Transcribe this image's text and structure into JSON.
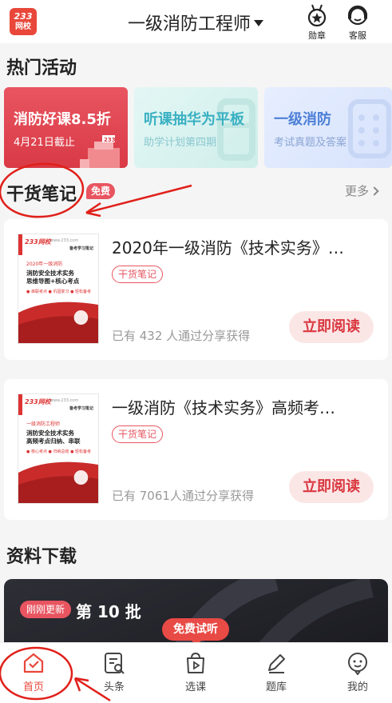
{
  "header": {
    "logo_line1": "233",
    "logo_line2": "网校",
    "title": "一级消防工程师",
    "badge_label": "勋章",
    "service_label": "客服"
  },
  "hot_activities": {
    "title": "热门活动",
    "cards": [
      {
        "title": "消防好课8.5折",
        "subtitle": "4月21日截止",
        "deco": "233"
      },
      {
        "title": "听课抽华为平板",
        "subtitle": "助学计划第四期"
      },
      {
        "title": "一级消防",
        "subtitle": "考试真题及答案"
      }
    ]
  },
  "notes": {
    "title": "干货笔记",
    "badge": "免费",
    "more_label": "更多",
    "items": [
      {
        "title": "2020年一级消防《技术实务》…",
        "tag": "干货笔记",
        "count_text": "已有 432 人通过分享获得",
        "button": "立即阅读",
        "cover": {
          "logo": "233网校",
          "url": "www.233.com",
          "tag": "备考学习笔记",
          "year": "2020年一级消防",
          "line1": "消防安全技术实务",
          "line2": "思维导图+核心考点",
          "dots": "● 串联考点  ● 巩固复习  ● 轻松备考"
        }
      },
      {
        "title": "一级消防《技术实务》高频考…",
        "tag": "干货笔记",
        "count_text": "已有 7061人通过分享获得",
        "button": "立即阅读",
        "cover": {
          "logo": "233网校",
          "url": "www.233.com",
          "tag": "备考学习笔记",
          "year": "一级消防工程师",
          "line1": "消防安全技术实务",
          "line2": "高频考点归纳、串联",
          "dots": "● 核心考点  ● 归纳总结  ● 轻松备考"
        }
      }
    ]
  },
  "downloads": {
    "title": "资料下载",
    "badge": "刚刚更新",
    "batch": "第 10 批"
  },
  "floating": {
    "trial_label": "免费试听"
  },
  "bottom_nav": [
    {
      "label": "首页",
      "icon": "home-icon",
      "active": true
    },
    {
      "label": "头条",
      "icon": "news-icon",
      "active": false
    },
    {
      "label": "选课",
      "icon": "course-bag-icon",
      "active": false
    },
    {
      "label": "题库",
      "icon": "pencil-icon",
      "active": false
    },
    {
      "label": "我的",
      "icon": "profile-face-icon",
      "active": false
    }
  ],
  "colors": {
    "brand_red": "#e8473a",
    "annotation_red": "#e0201a",
    "text_gray": "#999999"
  }
}
